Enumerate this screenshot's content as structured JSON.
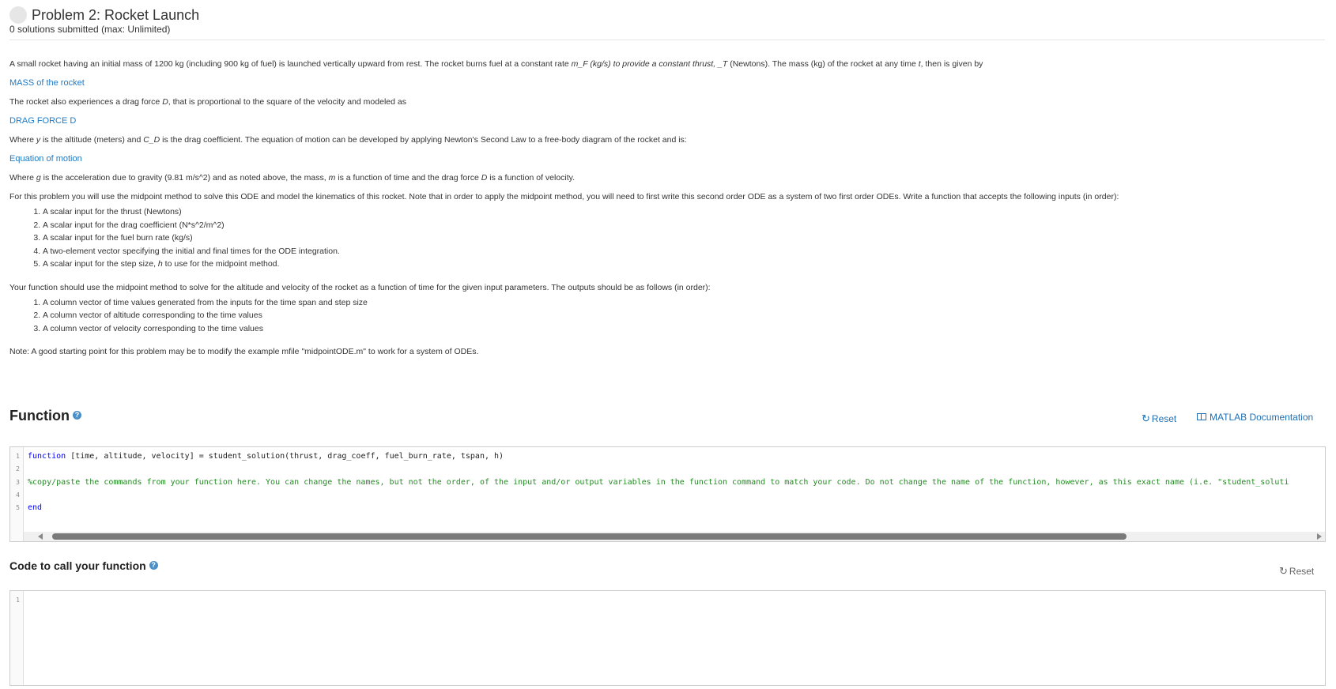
{
  "header": {
    "title": "Problem 2: Rocket Launch",
    "submissions": "0 solutions submitted (max: Unlimited)"
  },
  "description": {
    "intro": {
      "a": "A small rocket having an initial mass of 1200 kg (including 900 kg of fuel) is launched vertically upward from rest. The rocket burns fuel at a constant rate ",
      "b": "m_F (kg/s) to provide a constant thrust, _T",
      "c": " (Newtons). The mass (kg) of the rocket at any time ",
      "d": "t",
      "e": ", then is given by"
    },
    "link_mass": "MASS of the rocket",
    "drag_text": {
      "a": "The rocket also experiences a drag force ",
      "b": "D",
      "c": ", that is proportional to the square of the velocity and modeled as"
    },
    "link_drag": "DRAG FORCE D",
    "where_y": {
      "a": "Where ",
      "b": "y",
      "c": " is the altitude (meters) and ",
      "d": "C_D",
      "e": " is the drag coefficient. The equation of motion can be developed by applying Newton's Second Law to a free-body diagram of the rocket and is:"
    },
    "link_eom": "Equation of motion",
    "where_g": {
      "a": "Where ",
      "b": "g",
      "c": " is the acceleration due to gravity (9.81 m/s^2) and as noted above, the mass, ",
      "d": "m",
      "e": " is a function of time and the drag force ",
      "f": "D",
      "g": " is a function of velocity."
    },
    "task": "For this problem you will use the midpoint method to solve this ODE and model the kinematics of this rocket. Note that in order to apply the midpoint method, you will need to first write this second order ODE as a system of two first order ODEs. Write a function that accepts the following inputs (in order):",
    "inputs": {
      "i1": "A scalar input for the thrust (Newtons)",
      "i2": "A scalar input for the drag coefficient (N*s^2/m^2)",
      "i3": "A scalar input for the fuel burn rate (kg/s)",
      "i4": "A two-element vector specifying the initial and final times for the ODE integration.",
      "i5a": "A scalar input for the step size, ",
      "i5b": "h",
      "i5c": " to use for the midpoint method."
    },
    "outputs_intro": "Your function should use the midpoint method to solve for the altitude and velocity of the rocket as a function of time for the given input parameters. The outputs should be as follows (in order):",
    "outputs": {
      "o1": "A column vector of time values generated from the inputs for the time span and step size",
      "o2": "A column vector of altitude corresponding to the time values",
      "o3": "A column vector of velocity corresponding to the time values"
    },
    "note": "Note: A good starting point for this problem may be to modify the example mfile \"midpointODE.m\" to work for a system of ODEs."
  },
  "function_section": {
    "title": "Function",
    "reset_label": "Reset",
    "docs_label": "MATLAB Documentation"
  },
  "function_code": {
    "line_numbers": {
      "n1": "1",
      "n2": "2",
      "n3": "3",
      "n4": "4",
      "n5": "5"
    },
    "kw_function": "function",
    "signature": " [time, altitude, velocity] = student_solution(thrust, drag_coeff, fuel_burn_rate, tspan, h)",
    "comment": "%copy/paste the commands from your function here.  You can change the names, but not the order, of the input and/or output variables in the function command to match your code.  Do not change the name of the function, however, as this exact name (i.e. \"student_soluti",
    "kw_end": "end"
  },
  "call_section": {
    "title": "Code to call your function",
    "reset_label": "Reset",
    "line_number": "1"
  },
  "colors": {
    "link": "#1f7ac4",
    "keyword": "#0000ff",
    "comment": "#228b22",
    "help_icon": "#4a8fc7"
  },
  "icons": {
    "reset": "refresh-icon",
    "docs": "book-icon",
    "help": "question-circle-icon"
  }
}
